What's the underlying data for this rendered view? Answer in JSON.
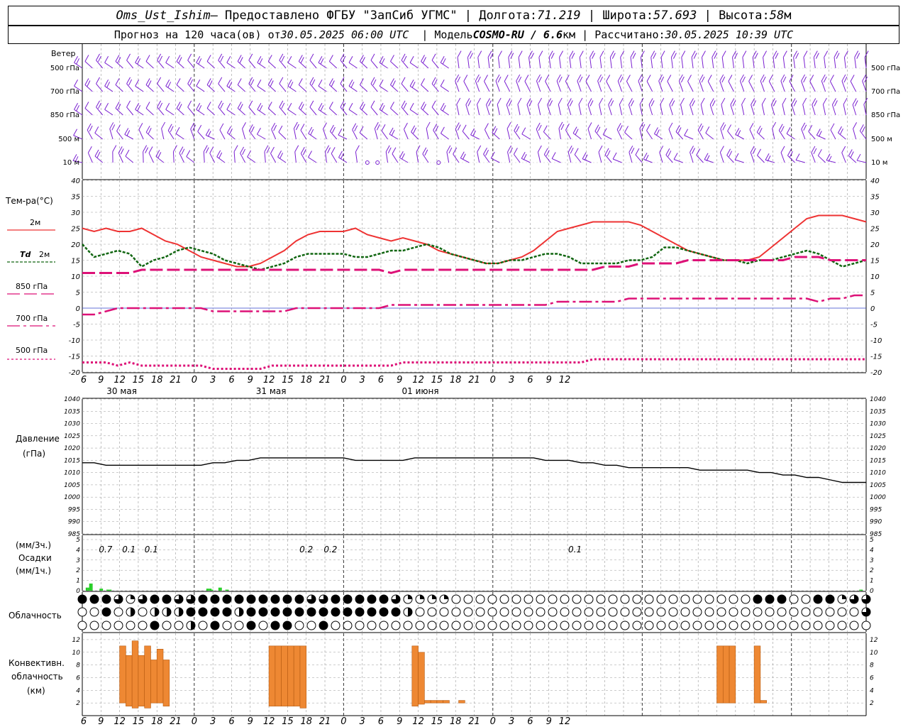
{
  "header": {
    "line1": {
      "station": "Oms_Ust_Ishim",
      "provided": "– Предоставлено ФГБУ \"ЗапСиб УГМС\"",
      "lon_label": "Долгота:",
      "lon": "71.219",
      "lat_label": "Широта:",
      "lat": "57.693",
      "alt_label": "Высота:",
      "alt": "58",
      "alt_unit": "м"
    },
    "line2": {
      "forecast": "Прогноз на 120 часа(ов) от",
      "start": "30.05.2025 06:00 UTC",
      "model_label": "Модель",
      "model": "COSMO-RU / 6.6",
      "model_unit": "км",
      "calc_label": "Рассчитано:",
      "calc": "30.05.2025 10:39 UTC"
    }
  },
  "chart_data": {
    "x_hours": [
      6,
      9,
      12,
      15,
      18,
      21,
      0,
      3,
      6,
      9,
      12,
      15,
      18,
      21,
      0,
      3,
      6,
      9,
      12,
      15,
      18,
      21,
      0,
      3,
      6,
      9,
      12
    ],
    "day_labels": [
      "30 мая",
      "31 мая",
      "01 июня"
    ],
    "wind": {
      "title": "Ветер",
      "levels": [
        "500 гПа",
        "700 гПа",
        "850 гПа",
        "500 м",
        "10  м"
      ]
    },
    "temperature": {
      "type": "line",
      "ylabel": "Тем-ра(°C)",
      "ylim": [
        -20,
        40
      ],
      "yticks": [
        -20,
        -15,
        -10,
        -5,
        0,
        5,
        10,
        15,
        20,
        25,
        30,
        35,
        40
      ],
      "legend": [
        {
          "key": "t2m",
          "label": "2м",
          "color": "#ee3333"
        },
        {
          "key": "td",
          "label_a": "Td",
          "label_b": "2м",
          "color": "#116611"
        },
        {
          "key": "t850",
          "label": "850 гПа",
          "color": "#dd1177"
        },
        {
          "key": "t700",
          "label": "700 гПа",
          "color": "#dd1177"
        },
        {
          "key": "t500",
          "label": "500 гПа",
          "color": "#dd1177"
        }
      ],
      "series": [
        {
          "key": "t2m",
          "values": [
            25,
            24,
            25,
            24,
            24,
            25,
            23,
            21,
            20,
            18,
            16,
            15,
            14,
            13,
            13,
            14,
            16,
            18,
            21,
            23,
            24,
            24,
            24,
            25,
            23,
            22,
            21,
            22,
            21,
            20,
            18,
            17,
            16,
            15,
            14,
            14,
            15,
            16,
            18,
            21,
            24,
            25,
            26,
            27,
            27,
            27,
            27,
            26,
            24,
            22,
            20,
            18,
            17,
            16,
            15,
            15,
            15,
            16,
            19,
            22,
            25,
            28,
            29,
            29,
            29,
            28,
            27
          ]
        },
        {
          "key": "td",
          "values": [
            20,
            16,
            17,
            18,
            17,
            13,
            15,
            16,
            18,
            19,
            18,
            17,
            15,
            14,
            13,
            12,
            13,
            14,
            16,
            17,
            17,
            17,
            17,
            16,
            16,
            17,
            18,
            18,
            19,
            20,
            19,
            17,
            16,
            15,
            14,
            14,
            15,
            15,
            16,
            17,
            17,
            16,
            14,
            14,
            14,
            14,
            15,
            15,
            16,
            19,
            19,
            18,
            17,
            16,
            15,
            15,
            14,
            15,
            15,
            16,
            17,
            18,
            17,
            15,
            13,
            14,
            15
          ]
        },
        {
          "key": "t850",
          "values": [
            11,
            11,
            11,
            11,
            11,
            12,
            12,
            12,
            12,
            12,
            12,
            12,
            12,
            12,
            12,
            12,
            12,
            12,
            12,
            12,
            12,
            12,
            12,
            12,
            12,
            12,
            11,
            12,
            12,
            12,
            12,
            12,
            12,
            12,
            12,
            12,
            12,
            12,
            12,
            12,
            12,
            12,
            12,
            12,
            13,
            13,
            13,
            14,
            14,
            14,
            14,
            15,
            15,
            15,
            15,
            15,
            15,
            15,
            15,
            15,
            16,
            16,
            16,
            15,
            15,
            15,
            15
          ]
        },
        {
          "key": "t700",
          "values": [
            -2,
            -2,
            -1,
            0,
            0,
            0,
            0,
            0,
            0,
            0,
            0,
            -1,
            -1,
            -1,
            -1,
            -1,
            -1,
            -1,
            0,
            0,
            0,
            0,
            0,
            0,
            0,
            0,
            1,
            1,
            1,
            1,
            1,
            1,
            1,
            1,
            1,
            1,
            1,
            1,
            1,
            1,
            2,
            2,
            2,
            2,
            2,
            2,
            3,
            3,
            3,
            3,
            3,
            3,
            3,
            3,
            3,
            3,
            3,
            3,
            3,
            3,
            3,
            3,
            2,
            3,
            3,
            4,
            4
          ]
        },
        {
          "key": "t500",
          "values": [
            -17,
            -17,
            -17,
            -18,
            -17,
            -18,
            -18,
            -18,
            -18,
            -18,
            -18,
            -19,
            -19,
            -19,
            -19,
            -19,
            -18,
            -18,
            -18,
            -18,
            -18,
            -18,
            -18,
            -18,
            -18,
            -18,
            -18,
            -17,
            -17,
            -17,
            -17,
            -17,
            -17,
            -17,
            -17,
            -17,
            -17,
            -17,
            -17,
            -17,
            -17,
            -17,
            -17,
            -16,
            -16,
            -16,
            -16,
            -16,
            -16,
            -16,
            -16,
            -16,
            -16,
            -16,
            -16,
            -16,
            -16,
            -16,
            -16,
            -16,
            -16,
            -16,
            -16,
            -16,
            -16,
            -16,
            -16
          ]
        }
      ]
    },
    "pressure": {
      "type": "line",
      "ylabel": "Давление",
      "yunit": "(гПа)",
      "ylim": [
        985,
        1040
      ],
      "yticks": [
        985,
        990,
        995,
        1000,
        1005,
        1010,
        1015,
        1020,
        1025,
        1030,
        1035,
        1040
      ],
      "values": [
        1014,
        1014,
        1013,
        1013,
        1013,
        1013,
        1013,
        1013,
        1013,
        1013,
        1013,
        1014,
        1014,
        1015,
        1015,
        1016,
        1016,
        1016,
        1016,
        1016,
        1016,
        1016,
        1016,
        1015,
        1015,
        1015,
        1015,
        1015,
        1016,
        1016,
        1016,
        1016,
        1016,
        1016,
        1016,
        1016,
        1016,
        1016,
        1016,
        1015,
        1015,
        1015,
        1014,
        1014,
        1013,
        1013,
        1012,
        1012,
        1012,
        1012,
        1012,
        1012,
        1011,
        1011,
        1011,
        1011,
        1011,
        1010,
        1010,
        1009,
        1009,
        1008,
        1008,
        1007,
        1006,
        1006,
        1006
      ]
    },
    "precip": {
      "type": "bar",
      "ylabel1": "(мм/3ч.)",
      "ylabel2": "Осадки",
      "ylabel3": "(мм/1ч.)",
      "ylim": [
        0,
        5
      ],
      "yticks": [
        0,
        1,
        2,
        3,
        4,
        5
      ],
      "labels": [
        {
          "hour_index": 0.75,
          "text": "0.7"
        },
        {
          "hour_index": 2.0,
          "text": "0.1"
        },
        {
          "hour_index": 3.2,
          "text": "0.1"
        },
        {
          "hour_index": 11.5,
          "text": "0.2"
        },
        {
          "hour_index": 12.8,
          "text": "0.2"
        },
        {
          "hour_index": 25.9,
          "text": "0.1"
        }
      ],
      "hourly": [
        0,
        0,
        0.3,
        0.3,
        0.7,
        0.7,
        0,
        0,
        0,
        0,
        0.2,
        0.2,
        0,
        0,
        0.1,
        0.1,
        0.1,
        0,
        0,
        0,
        0,
        0,
        0,
        0,
        0,
        0,
        0,
        0,
        0,
        0,
        0,
        0,
        0,
        0,
        0,
        0,
        0,
        0,
        0,
        0,
        0,
        0,
        0,
        0,
        0,
        0,
        0,
        0,
        0,
        0,
        0,
        0,
        0,
        0,
        0,
        0,
        0,
        0,
        0,
        0,
        0,
        0,
        0,
        0,
        0,
        0,
        0,
        0,
        0,
        0,
        0,
        0,
        0.2,
        0.2,
        0.2,
        0.1,
        0,
        0,
        0,
        0.3,
        0.3,
        0,
        0,
        0.1,
        0.1,
        0,
        0,
        0,
        0,
        0,
        0,
        0,
        0,
        0,
        0,
        0,
        0,
        0,
        0,
        0,
        0,
        0,
        0,
        0,
        0,
        0,
        0,
        0,
        0,
        0,
        0,
        0,
        0,
        0,
        0,
        0,
        0,
        0,
        0,
        0,
        0,
        0,
        0,
        0,
        0,
        0,
        0,
        0,
        0,
        0,
        0,
        0,
        0,
        0,
        0,
        0,
        0,
        0,
        0,
        0,
        0,
        0,
        0,
        0,
        0,
        0,
        0,
        0,
        0,
        0,
        0,
        0,
        0,
        0,
        0,
        0,
        0,
        0,
        0,
        0,
        0,
        0,
        0,
        0,
        0,
        0,
        0,
        0,
        0,
        0,
        0,
        0,
        0,
        0,
        0,
        0,
        0,
        0,
        0,
        0,
        0,
        0,
        0,
        0,
        0,
        0,
        0,
        0,
        0,
        0,
        0,
        0,
        0,
        0,
        0,
        0,
        0,
        0,
        0,
        0,
        0,
        0,
        0,
        0,
        0,
        0,
        0,
        0,
        0,
        0,
        0,
        0,
        0,
        0,
        0,
        0,
        0,
        0,
        0,
        0,
        0,
        0,
        0,
        0,
        0,
        0,
        0,
        0,
        0,
        0,
        0,
        0,
        0,
        0,
        0,
        0,
        0,
        0,
        0,
        0,
        0,
        0,
        0,
        0,
        0,
        0,
        0,
        0,
        0,
        0,
        0,
        0,
        0,
        0,
        0,
        0,
        0,
        0,
        0,
        0,
        0,
        0,
        0,
        0,
        0,
        0,
        0,
        0,
        0,
        0,
        0,
        0,
        0,
        0,
        0,
        0,
        0,
        0,
        0,
        0,
        0,
        0,
        0,
        0,
        0,
        0,
        0,
        0,
        0,
        0,
        0,
        0,
        0,
        0,
        0,
        0,
        0,
        0,
        0,
        0,
        0,
        0,
        0,
        0,
        0,
        0,
        0,
        0,
        0,
        0,
        0,
        0,
        0,
        0,
        0,
        0,
        0,
        0,
        0,
        0,
        0,
        0,
        0,
        0,
        0,
        0,
        0,
        0,
        0,
        0,
        0,
        0,
        0,
        0,
        0,
        0,
        0,
        0,
        0,
        0,
        0,
        0,
        0,
        0,
        0,
        0,
        0,
        0,
        0,
        0,
        0,
        0,
        0,
        0,
        0,
        0,
        0,
        0,
        0,
        0,
        0,
        0,
        0,
        0,
        0,
        0,
        0,
        0,
        0,
        0,
        0,
        0,
        0,
        0,
        0,
        0,
        0,
        0,
        0,
        0,
        0,
        0,
        0,
        0,
        0,
        0,
        0,
        0,
        0,
        0,
        0,
        0,
        0,
        0,
        0,
        0,
        0,
        0,
        0,
        0,
        0,
        0,
        0,
        0,
        0,
        0,
        0,
        0,
        0,
        0,
        0,
        0,
        0,
        0,
        0,
        0,
        0,
        0,
        0,
        0,
        0,
        0,
        0,
        0,
        0,
        0,
        0,
        0,
        0,
        0,
        0,
        0,
        0,
        0,
        0,
        0,
        0,
        0,
        0,
        0,
        0,
        0,
        0,
        0,
        0,
        0,
        0,
        0,
        0,
        0,
        0,
        0.1,
        0.1,
        0,
        0
      ]
    },
    "cloud": {
      "label": "Облачность",
      "rows": [
        "4344433210034444434334444444444444444444433334444444444444311111111110000004000000000000000000000000000000000000000000000000443433440000444431333344",
        "0200440320032202320444444422304444444444444444444444444433200000000000000000000000000000000000000000000000000000000000000000000000000020000340",
        "0000000000004000000200044000004403404404040400000000000000000000000000000000000000000000000000000000000000000000000000000000000000000000000000"
      ]
    },
    "convective": {
      "type": "bar",
      "ylabel1": "Конвективн.",
      "ylabel2": "облачность",
      "ylabel3": "(км)",
      "ylim": [
        0,
        13
      ],
      "yticks": [
        2,
        4,
        6,
        8,
        10,
        12
      ],
      "bars": [
        {
          "from": 6.0,
          "to": 7.0,
          "base": 2,
          "top": 11
        },
        {
          "from": 7.0,
          "to": 8.0,
          "base": 1.5,
          "top": 9.5
        },
        {
          "from": 8.0,
          "to": 9.0,
          "base": 1.2,
          "top": 11.8
        },
        {
          "from": 9.0,
          "to": 10.0,
          "base": 1.5,
          "top": 9.5
        },
        {
          "from": 10.0,
          "to": 11.0,
          "base": 1.2,
          "top": 11
        },
        {
          "from": 11.0,
          "to": 12.0,
          "base": 2,
          "top": 8.8
        },
        {
          "from": 12.0,
          "to": 13.0,
          "base": 2,
          "top": 10.5
        },
        {
          "from": 13.0,
          "to": 14.0,
          "base": 1.5,
          "top": 8.8
        },
        {
          "from": 30.0,
          "to": 31.0,
          "base": 1.5,
          "top": 11
        },
        {
          "from": 31.0,
          "to": 32.0,
          "base": 1.5,
          "top": 11
        },
        {
          "from": 32.0,
          "to": 33.0,
          "base": 1.5,
          "top": 11
        },
        {
          "from": 33.0,
          "to": 34.0,
          "base": 1.5,
          "top": 11
        },
        {
          "from": 34.0,
          "to": 35.0,
          "base": 1.5,
          "top": 11
        },
        {
          "from": 35.0,
          "to": 36.0,
          "base": 1.2,
          "top": 11
        },
        {
          "from": 53.0,
          "to": 54.0,
          "base": 1.5,
          "top": 11
        },
        {
          "from": 54.0,
          "to": 55.0,
          "base": 1.8,
          "top": 10
        },
        {
          "from": 55.0,
          "to": 56.0,
          "base": 2,
          "top": 2.4
        },
        {
          "from": 56.0,
          "to": 57.0,
          "base": 2,
          "top": 2.4
        },
        {
          "from": 57.0,
          "to": 58.0,
          "base": 2,
          "top": 2.4
        },
        {
          "from": 58.0,
          "to": 59.0,
          "base": 2,
          "top": 2.4
        },
        {
          "from": 60.5,
          "to": 61.5,
          "base": 2,
          "top": 2.4
        },
        {
          "from": 102.0,
          "to": 103.0,
          "base": 2,
          "top": 11
        },
        {
          "from": 103.0,
          "to": 104.0,
          "base": 2,
          "top": 11
        },
        {
          "from": 104.0,
          "to": 105.0,
          "base": 2,
          "top": 11
        },
        {
          "from": 108.0,
          "to": 109.0,
          "base": 2,
          "top": 11
        },
        {
          "from": 109.0,
          "to": 110.0,
          "base": 2,
          "top": 2.4
        }
      ]
    }
  },
  "colors": {
    "wind": "#7a1fd1",
    "t2m": "#ee3333",
    "td": "#116611",
    "mag": "#dd1177",
    "pressure": "#000000",
    "precip": "#22cc22",
    "conv": "#ee8833",
    "grid": "#999999"
  }
}
